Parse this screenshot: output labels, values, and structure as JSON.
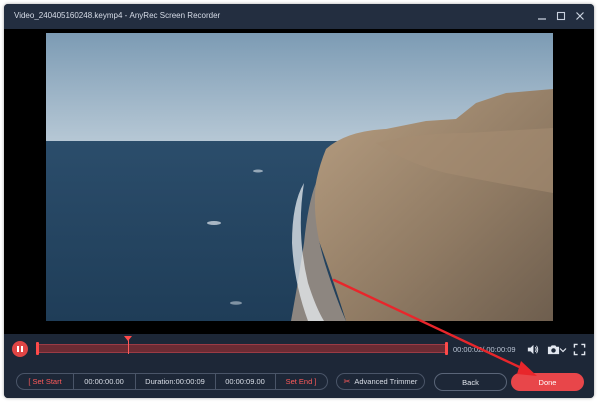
{
  "window": {
    "title": "Video_240405160248.keymp4",
    "app_name": "AnyRec Screen Recorder",
    "minimize_icon": "minimize-icon",
    "maximize_icon": "maximize-icon",
    "close_icon": "close-icon"
  },
  "timeline": {
    "time_readout": "00:00:02/ 00:00:09",
    "progress": 0.22,
    "pause_icon": "pause-icon",
    "volume_icon": "speaker-icon",
    "screenshot_icon": "camera-icon",
    "fullscreen_icon": "fullscreen-icon"
  },
  "trim": {
    "set_start_label": "Set Start",
    "start_time": "00:00:00.00",
    "duration": "Duration:00:00:09",
    "end_time": "00:00:09.00",
    "set_end_label": "Set End",
    "advanced_trimmer_label": "Advanced Trimmer"
  },
  "actions": {
    "back_label": "Back",
    "done_label": "Done"
  },
  "colors": {
    "accent": "#e8464a",
    "background": "#1d2737",
    "annotation_arrow": "#e8262b"
  }
}
